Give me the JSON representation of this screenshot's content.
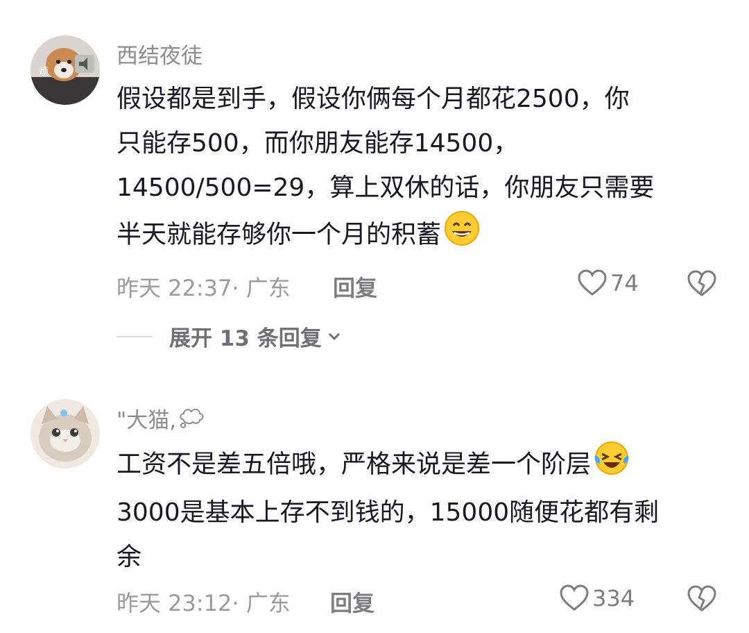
{
  "comments": [
    {
      "username": "西结夜徒",
      "avatar_badge": "烦",
      "lines": [
        "假设都是到手，假设你俩每个月都花2500，你",
        "只能存500，而你朋友能存14500，",
        "14500/500=29，算上双休的话，你朋友只需要",
        "半天就能存够你一个月的积蓄"
      ],
      "emoji": "grinning-squint-emoji",
      "time_location": "昨天 22:37· 广东",
      "reply_label": "回复",
      "likes": "74",
      "expand_label": "展开 13 条回复"
    },
    {
      "username": "\"大猫,",
      "username_emoji": "thought-bubble-icon",
      "lines": [
        "工资不是差五倍哦，严格来说是差一个阶层",
        "3000是基本上存不到钱的，15000随便花都有剩",
        "余"
      ],
      "emoji": "laughing-crying-emoji",
      "time_location": "昨天 23:12· 广东",
      "reply_label": "回复",
      "likes": "334"
    }
  ],
  "icons": {
    "like": "heart-outline-icon",
    "dislike": "broken-heart-icon",
    "expand": "chevron-down-icon"
  }
}
